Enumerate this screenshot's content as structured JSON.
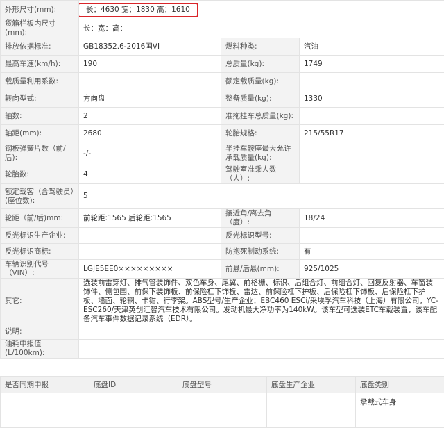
{
  "spec": {
    "dimensions": {
      "label": "外形尺寸(mm):",
      "value": "长：4630 宽：1830 高：1610"
    },
    "cargo_box": {
      "label": "货箱栏板内尺寸(mm):",
      "value": "长：宽：高："
    },
    "emission": {
      "label": "排放依据标准:",
      "value": "GB18352.6-2016国VI"
    },
    "fuel_type": {
      "label": "燃料种类:",
      "value": "汽油"
    },
    "max_speed": {
      "label": "最高车速(km/h):",
      "value": "190"
    },
    "total_mass": {
      "label": "总质量(kg):",
      "value": "1749"
    },
    "load_util": {
      "label": "载质量利用系数:",
      "value": ""
    },
    "rated_load": {
      "label": "额定载质量(kg):",
      "value": ""
    },
    "steering": {
      "label": "转向型式:",
      "value": "方向盘"
    },
    "curb_weight": {
      "label": "整备质量(kg):",
      "value": "1330"
    },
    "axles": {
      "label": "轴数:",
      "value": "2"
    },
    "trailer_mass": {
      "label": "准拖挂车总质量(kg):",
      "value": ""
    },
    "wheelbase": {
      "label": "轴距(mm):",
      "value": "2680"
    },
    "tire_spec": {
      "label": "轮胎规格:",
      "value": "215/55R17"
    },
    "leaf_springs": {
      "label": "钢板弹簧片数（前/后):",
      "value": "-/-"
    },
    "saddle_mass": {
      "label": "半挂车鞍座最大允许承载质量(kg):",
      "value": ""
    },
    "tire_count": {
      "label": "轮胎数:",
      "value": "4"
    },
    "cab_passengers": {
      "label": "驾驶室准乘人数（人）:",
      "value": ""
    },
    "rated_seats": {
      "label": "额定载客（含驾驶员）(座位数):",
      "value": "5"
    },
    "track": {
      "label": "轮距（前/后)mm:",
      "value": "前轮距:1565 后轮距:1565"
    },
    "approach_angle": {
      "label": "接近角/离去角（度）:",
      "value": "18/24"
    },
    "reflector_maker": {
      "label": "反光标识生产企业:",
      "value": ""
    },
    "reflector_model": {
      "label": "反光标识型号:",
      "value": ""
    },
    "reflector_brand": {
      "label": "反光标识商标:",
      "value": ""
    },
    "abs": {
      "label": "防抱死制动系统:",
      "value": "有"
    },
    "vin": {
      "label": "车辆识别代号（VIN）:",
      "value": "LGJE5EE0×××××××××"
    },
    "overhang": {
      "label": "前悬/后悬(mm):",
      "value": "925/1025"
    },
    "other": {
      "label": "其它:",
      "value": "选装前雷穿灯、排气管装饰件、双色车身、尾翼、前格栅、标识、后组合灯、前组合灯、回复反射器、车窗装饰件、侧包围、前保下装饰板、前保险杠下饰板、雷达、前保险杠下护板、后保险杠下饰板、后保险杠下护板、墙面、轮辋、卡钳、行李架。ABS型号/生产企业：EBC460 ESCi/采埃孚汽车科技（上海）有限公司，YC-ESC260/天津英创汇智汽车技术有限公司。发动机最大净功率为140kW。该车型可选装ETC车载装置，该车配备汽车事件数据记录系统（EDR）。"
    },
    "notes": {
      "label": "说明:",
      "value": ""
    },
    "fuel_consumption": {
      "label": "油耗申报值(L/100km):",
      "value": ""
    }
  },
  "chassis": {
    "headers": [
      "是否同期申报",
      "底盘ID",
      "底盘型号",
      "底盘生产企业",
      "底盘类别"
    ],
    "row": [
      "",
      "",
      "",
      "",
      "承载式车身"
    ]
  },
  "colors": {
    "highlight_border": "#d9252a",
    "label_bg": "#f3f3f3",
    "grid": "#e3e3e3"
  }
}
